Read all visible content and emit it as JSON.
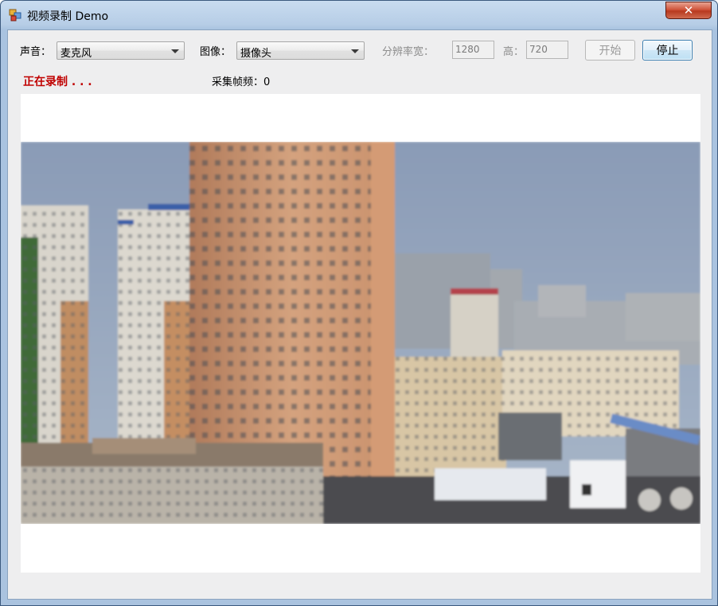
{
  "window": {
    "title": "视频录制 Demo",
    "close_glyph": "✕"
  },
  "controls": {
    "audio": {
      "label": "声音：",
      "selected": "麦克风"
    },
    "video": {
      "label": "图像：",
      "selected": "摄像头"
    },
    "resolution": {
      "width_label": "分辨率宽：",
      "width_value": "1280",
      "height_label": "高：",
      "height_value": "720"
    },
    "start_label": "开始",
    "stop_label": "停止"
  },
  "status": {
    "recording_text": "正在录制 . . .",
    "frames_label": "采集帧频：",
    "frames_value": "0"
  },
  "icons": {
    "app": "app-window-icon",
    "close": "close-icon",
    "dropdown": "chevron-down-icon"
  },
  "colors": {
    "recording_text": "#c00000",
    "close_button": "#c9442a",
    "active_button_border": "#3c7fb1"
  }
}
